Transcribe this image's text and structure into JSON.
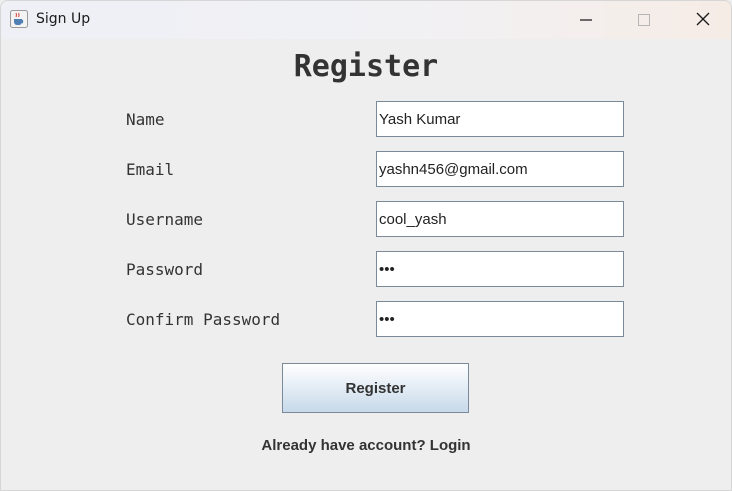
{
  "window": {
    "title": "Sign Up",
    "icons": {
      "app": "java-cup-icon",
      "minimize": "minimize-icon",
      "maximize": "maximize-icon",
      "close": "close-icon"
    }
  },
  "form": {
    "heading": "Register",
    "fields": [
      {
        "label": "Name",
        "value": "Yash Kumar"
      },
      {
        "label": "Email",
        "value": "yashn456@gmail.com"
      },
      {
        "label": "Username",
        "value": "cool_yash"
      },
      {
        "label": "Password",
        "value": "•••"
      },
      {
        "label": "Confirm Password",
        "value": "•••"
      }
    ],
    "register_label": "Register",
    "login_text": "Already have account? Login"
  },
  "colors": {
    "background": "#eeeeee",
    "text": "#333333",
    "field_border": "#7a8a99",
    "button_gradient_bottom": "#c7d9ea"
  }
}
